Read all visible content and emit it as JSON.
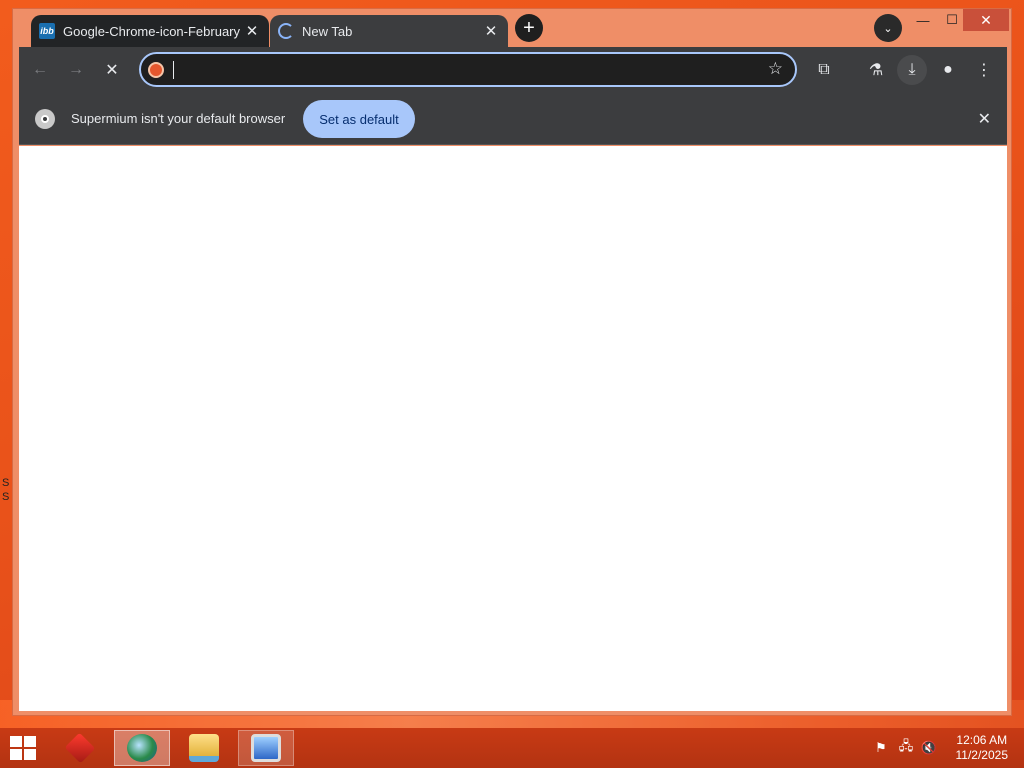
{
  "desktop": {
    "edge_text": [
      "S",
      "S"
    ]
  },
  "window": {
    "tabs": [
      {
        "title": "Google-Chrome-icon-February",
        "favicon": "ibb",
        "active": false
      },
      {
        "title": "New Tab",
        "active": true
      }
    ],
    "new_tab_icon": "+",
    "tab_search_icon": "⌄",
    "controls": {
      "minimize": "—",
      "maximize": "☐",
      "close": "✕"
    }
  },
  "toolbar": {
    "back_icon": "←",
    "forward_icon": "→",
    "stop_icon": "✕",
    "address_value": "",
    "address_placeholder": "",
    "bookmark_icon": "☆",
    "extensions_icon": "⧉",
    "labs_icon": "⚗",
    "download_icon": "⤓",
    "profile_icon": "●",
    "menu_icon": "⋮"
  },
  "infobar": {
    "message": "Supermium isn't your default browser",
    "button_label": "Set as default",
    "close_icon": "✕"
  },
  "taskbar": {
    "tray": {
      "flag_icon": "⚑",
      "network_icon": "🖧",
      "volume_icon": "🔇"
    },
    "clock": {
      "time": "12:06 AM",
      "date": "11/2/2025"
    }
  },
  "colors": {
    "accent": "#a8c7fa",
    "toolbar": "#3c3d3f",
    "desktop": "#ea541b",
    "taskbar": "#c13a15"
  }
}
